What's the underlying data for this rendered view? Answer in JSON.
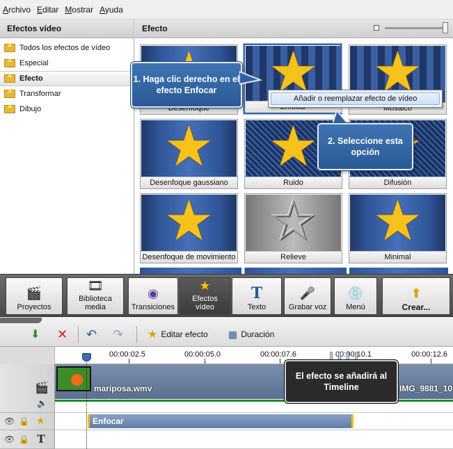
{
  "menu": [
    "Archivo",
    "Editar",
    "Mostrar",
    "Ayuda"
  ],
  "left_panel": {
    "title": "Efectos vídeo",
    "items": [
      {
        "label": "Todos los efectos de vídeo"
      },
      {
        "label": "Especial"
      },
      {
        "label": "Efecto",
        "selected": true
      },
      {
        "label": "Transformar"
      },
      {
        "label": "Dibujo"
      }
    ]
  },
  "right_panel": {
    "title": "Efecto",
    "tiles": [
      {
        "label": "Desenfoque"
      },
      {
        "label": "Enfocar",
        "selected": true
      },
      {
        "label": "Mosaico"
      },
      {
        "label": "Desenfoque gaussiano"
      },
      {
        "label": "Ruido"
      },
      {
        "label": "Difusión"
      },
      {
        "label": "Desenfoque de movimiento"
      },
      {
        "label": "Relieve"
      },
      {
        "label": "Minimal"
      }
    ]
  },
  "context_menu": {
    "item": "Añadir o reemplazar efecto de vídeo"
  },
  "callouts": {
    "step1": "1. Haga clic derecho en el efecto Enfocar",
    "step2": "2. Seleccione esta opción",
    "timeline_note": "El efecto se añadirá al Timeline"
  },
  "toolbar": {
    "projects": "Proyectos",
    "library": "Biblioteca media",
    "transitions": "Transiciones",
    "effects": "Efectos vídeo",
    "text": "Texto",
    "record_voice": "Grabar voz",
    "menu": "Menú",
    "create": "Crear..."
  },
  "timeline_toolbar": {
    "edit_effect": "Editar efecto",
    "duration": "Duración"
  },
  "ruler": {
    "marks": [
      "00:00:02.5",
      "00:00:05.0",
      "00:00:07.6",
      "00:00:10.1",
      "00:00:12.6"
    ]
  },
  "tracks": {
    "video_clip": "mariposa.wmv",
    "video_clip2": "IMG_9881_10",
    "effect_clip": "Enfocar"
  },
  "colors": {
    "accent": "#3b67a3",
    "callout": "#2f61a0",
    "effect_clip_border": "#f2c200",
    "audio_line": "#1f8a28"
  }
}
